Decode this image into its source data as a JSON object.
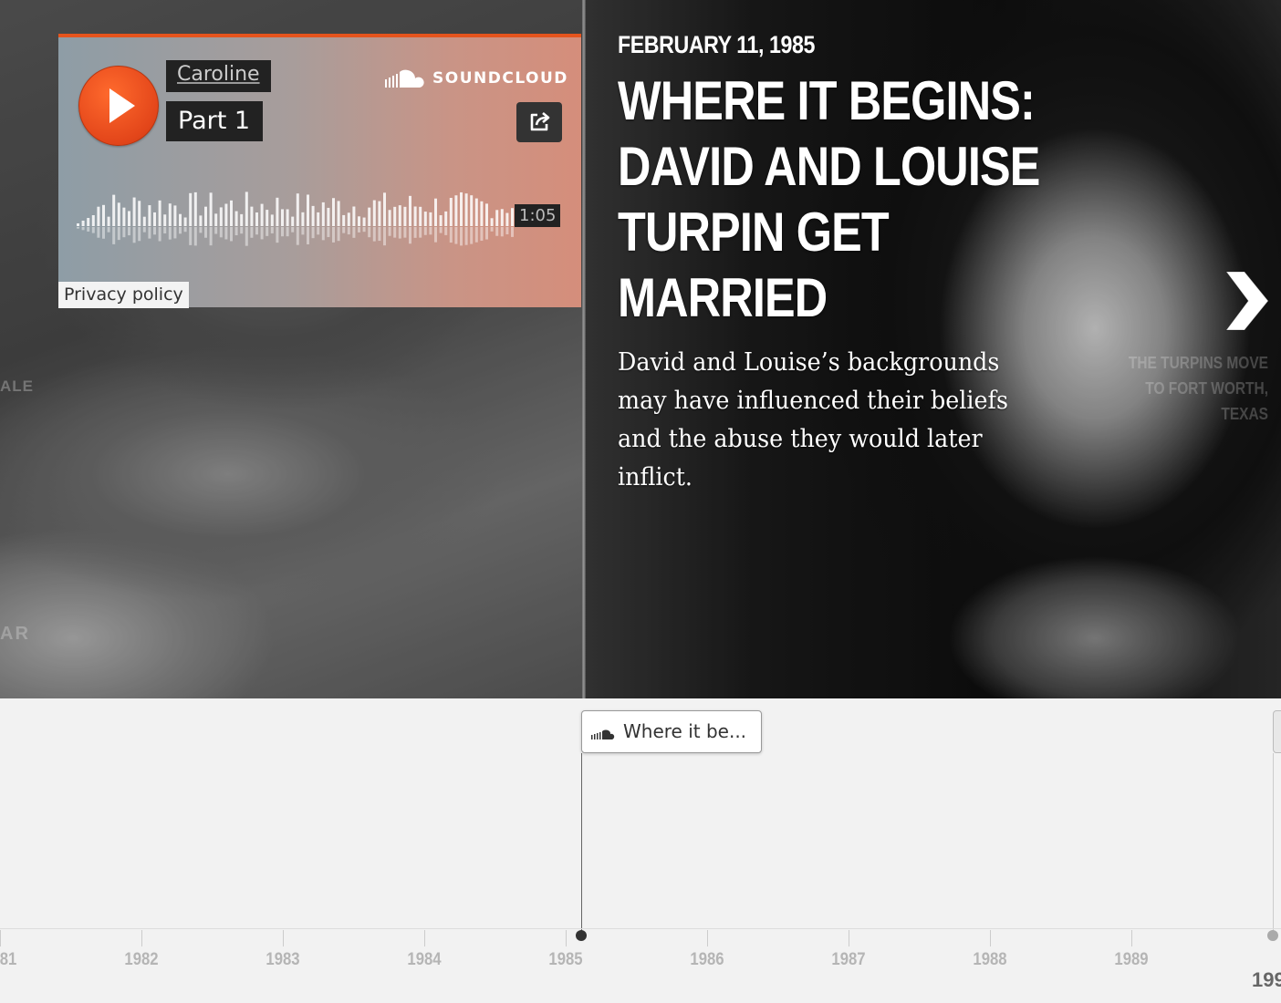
{
  "slide": {
    "date": "FEBRUARY 11, 1985",
    "headline": "WHERE IT BEGINS: DAVID AND LOUISE TURPIN GET MARRIED",
    "body": "David and Louise’s backgrounds may have influenced their beliefs and the abuse they would later inflict.",
    "prev_slide_label_fragment": "ALE",
    "left_photo_text_fragment": "AR",
    "next_slide_label": "THE TURPINS MOVE TO FORT WORTH, TEXAS",
    "next_icon": "chevron-right-icon"
  },
  "soundcloud": {
    "user": "Caroline",
    "track": "Part 1",
    "brand": "SOUNDCLOUD",
    "duration": "1:05",
    "privacy_link": "Privacy policy",
    "play_icon": "play-icon",
    "share_icon": "share-icon",
    "accent_color": "#e5541d"
  },
  "timeline": {
    "active_marker_label": "Where it be...",
    "active_marker_icon": "soundcloud-icon",
    "years": [
      "81",
      "1982",
      "1983",
      "1984",
      "1985",
      "1986",
      "1987",
      "1988",
      "1989"
    ],
    "major_year_fragment": "199"
  }
}
